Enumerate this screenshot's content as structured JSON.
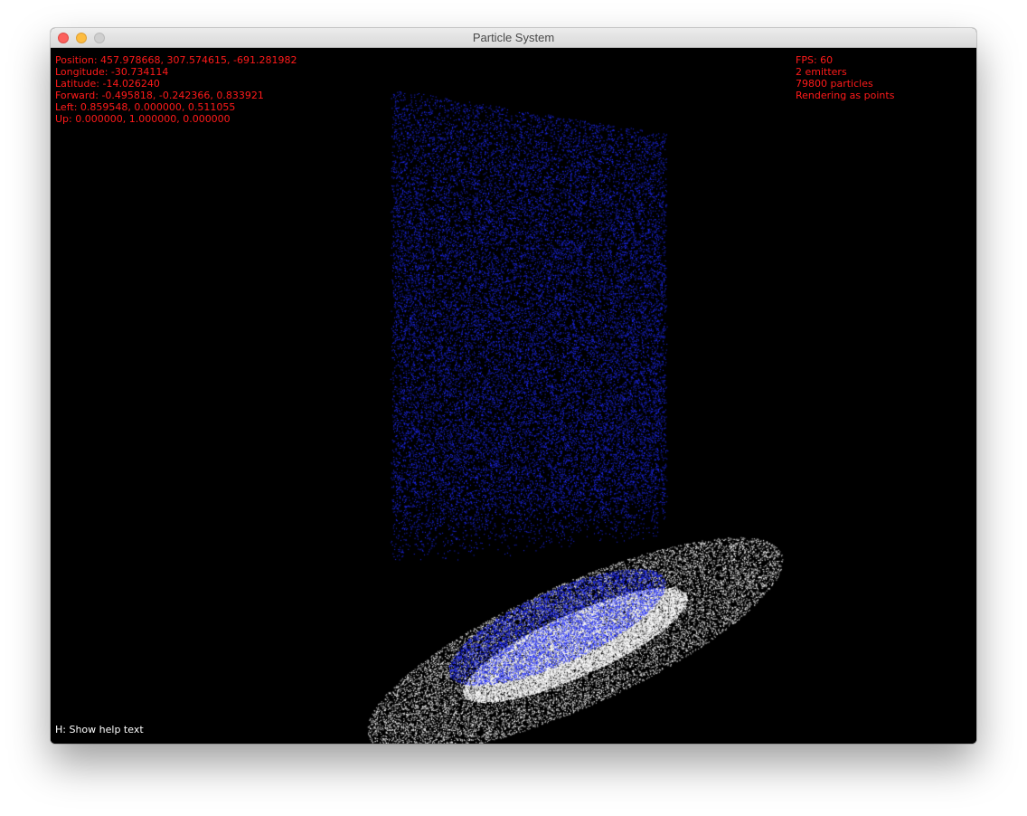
{
  "window": {
    "title": "Particle System",
    "controls": [
      "close-button",
      "minimize-button",
      "zoom-button"
    ]
  },
  "camera": {
    "position": "Position: 457.978668, 307.574615, -691.281982",
    "longitude": "Longitude: -30.734114",
    "latitude": "Latitude: -14.026240",
    "forward": "Forward: -0.495818, -0.242366, 0.833921",
    "left": "Left: 0.859548, 0.000000, 0.511055",
    "up": "Up: 0.000000, 1.000000, 0.000000"
  },
  "stats": {
    "fps": "FPS: 60",
    "emitters": "2 emitters",
    "particles": "79800 particles",
    "render_mode": "Rendering as points"
  },
  "help": {
    "text": "H: Show help text"
  },
  "colors": {
    "hud_text": "#ff1a1a",
    "help_text": "#ffffff",
    "background": "#000000",
    "emitter_blue": "#1f2bff",
    "emitter_white": "#ffffff"
  }
}
